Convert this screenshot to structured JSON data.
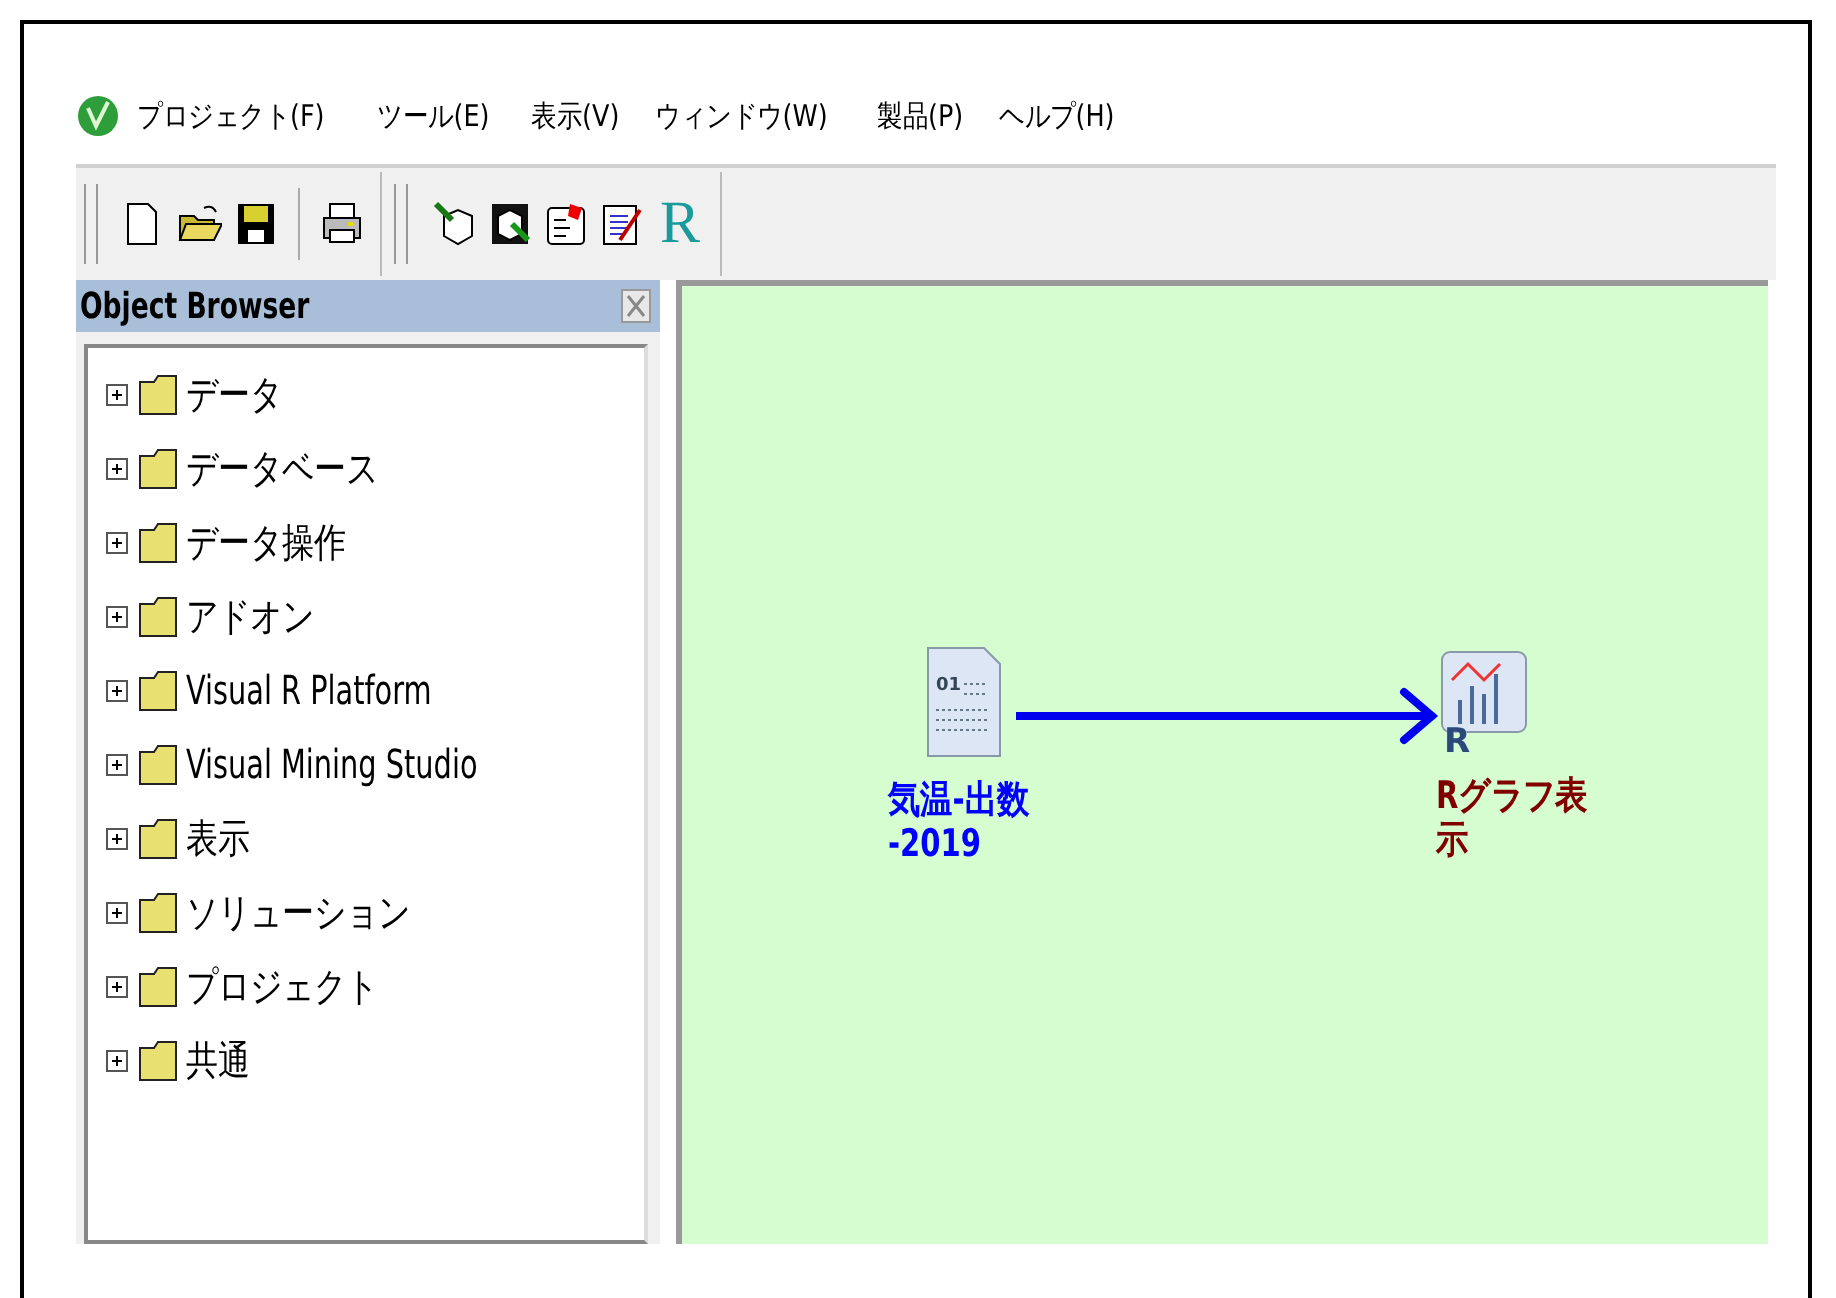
{
  "menu": [
    {
      "label": "プロジェクト(F)"
    },
    {
      "label": "ツール(E)"
    },
    {
      "label": "表示(V)"
    },
    {
      "label": "ウィンドウ(W)"
    },
    {
      "label": "製品(P)"
    },
    {
      "label": "ヘルプ(H)"
    }
  ],
  "toolbar": {
    "r_logo": "R"
  },
  "object_browser": {
    "title": "Object Browser",
    "items": [
      {
        "label": "データ",
        "expanded": false
      },
      {
        "label": "データベース",
        "expanded": false
      },
      {
        "label": "データ操作",
        "expanded": false
      },
      {
        "label": "アドオン",
        "expanded": false
      },
      {
        "label": "Visual R Platform",
        "expanded": false
      },
      {
        "label": "Visual Mining Studio",
        "expanded": false
      },
      {
        "label": "表示",
        "expanded": false
      },
      {
        "label": "ソリューション",
        "expanded": false
      },
      {
        "label": "プロジェクト",
        "expanded": false
      },
      {
        "label": "共通",
        "expanded": false
      }
    ]
  },
  "canvas": {
    "nodes": [
      {
        "kind": "data",
        "icon_text": "01",
        "label_lines": [
          "気温-出数",
          "-2019"
        ],
        "color": "#0000ff"
      },
      {
        "kind": "rgraph",
        "icon_text": "R",
        "label_lines": [
          "Rグラフ表",
          "示"
        ],
        "color": "#800000"
      }
    ]
  }
}
